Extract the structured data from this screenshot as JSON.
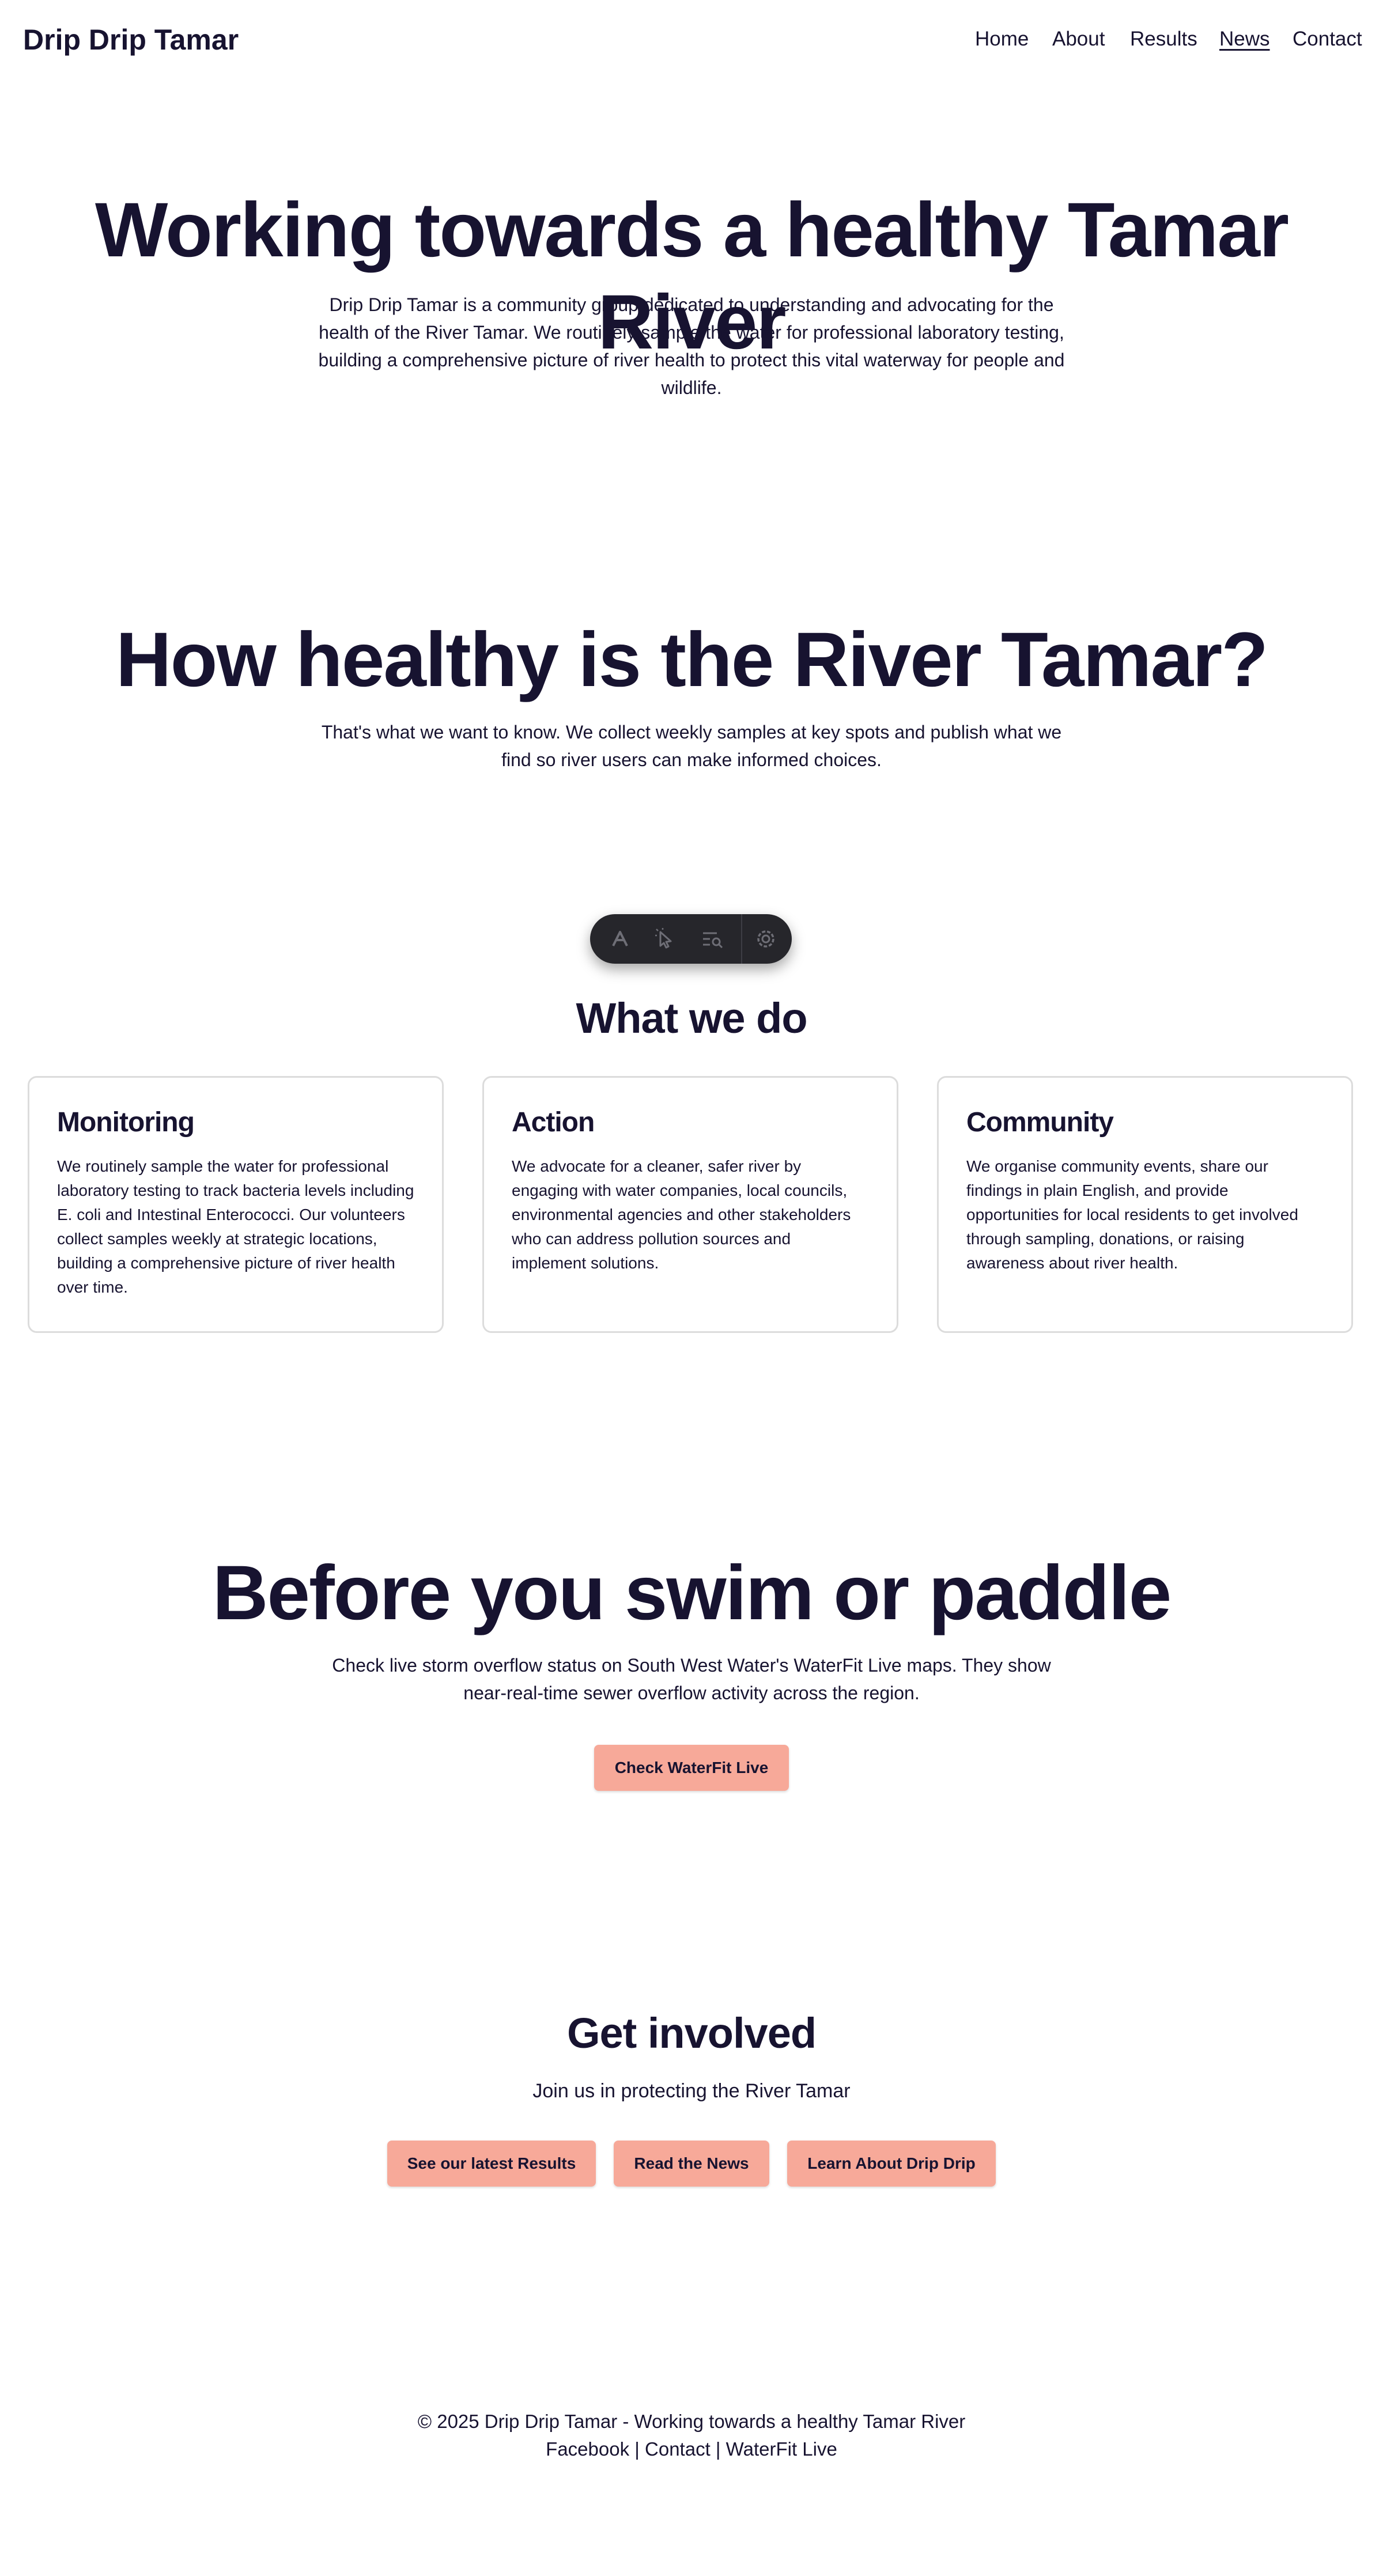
{
  "header": {
    "brand": "Drip Drip Tamar",
    "nav": [
      {
        "label": "Home"
      },
      {
        "label": "About"
      },
      {
        "label": "Results"
      },
      {
        "label": "News",
        "current": true
      },
      {
        "label": "Contact"
      }
    ]
  },
  "hero": {
    "title": "Working towards a healthy Tamar River",
    "lede": "Drip Drip Tamar is a community group dedicated to understanding and advocating for the health of the River Tamar. We routinely sample the water for professional laboratory testing, building a comprehensive picture of river health to protect this vital waterway for people and wildlife."
  },
  "health": {
    "title": "How healthy is the River Tamar?",
    "lede": "That's what we want to know. We collect weekly samples at key spots and publish what we find so river users can make informed choices."
  },
  "toolbar": {
    "icons": [
      "logo-icon",
      "cursor-icon",
      "search-list-icon",
      "gear-icon"
    ]
  },
  "whatwedo": {
    "title": "What we do",
    "cards": [
      {
        "title": "Monitoring",
        "text": "We routinely sample the water for professional laboratory testing to track bacteria levels including E. coli and Intestinal Enterococci. Our volunteers collect samples weekly at strategic locations, building a comprehensive picture of river health over time."
      },
      {
        "title": "Action",
        "text": "We advocate for a cleaner, safer river by engaging with water companies, local councils, environmental agencies and other stakeholders who can address pollution sources and implement solutions."
      },
      {
        "title": "Community",
        "text": "We organise community events, share our findings in plain English, and provide opportunities for local residents to get involved through sampling, donations, or raising awareness about river health."
      }
    ]
  },
  "swim": {
    "title": "Before you swim or paddle",
    "lede": "Check live storm overflow status on South West Water's WaterFit Live maps. They show near-real-time sewer overflow activity across the region.",
    "button": "Check WaterFit Live"
  },
  "involved": {
    "title": "Get involved",
    "subtitle": "Join us in protecting the River Tamar",
    "buttons": [
      "See our latest Results",
      "Read the News",
      "Learn About Drip Drip"
    ]
  },
  "footer": {
    "copyright": "© 2025 Drip Drip Tamar - Working towards a healthy Tamar River",
    "links": [
      "Facebook",
      "Contact",
      "WaterFit Live"
    ],
    "separator": "|"
  },
  "colors": {
    "text": "#171330",
    "button": "#f7a999",
    "toolbar": "#26262b",
    "card_border": "#dcdcdc"
  }
}
